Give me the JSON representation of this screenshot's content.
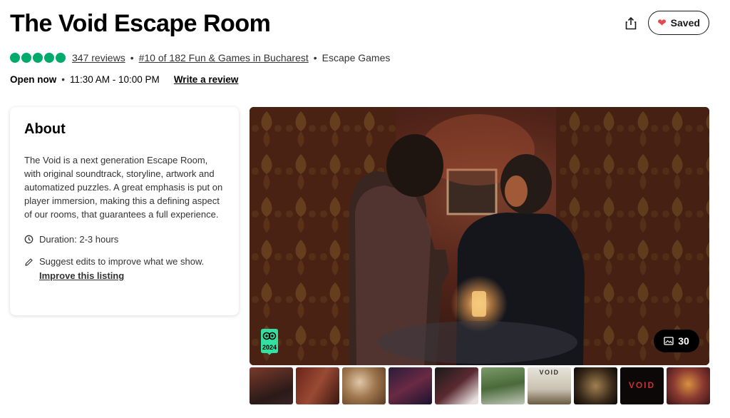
{
  "title": "The Void Escape Room",
  "header": {
    "saved_label": "Saved"
  },
  "rating": {
    "bubbles": 5,
    "reviews_link": "347 reviews",
    "ranking_link": "#10 of 182 Fun & Games in Bucharest",
    "category": "Escape Games"
  },
  "hours": {
    "status": "Open now",
    "time": "11:30 AM - 10:00 PM",
    "write_review": "Write a review"
  },
  "about": {
    "title": "About",
    "description": "The Void is a next generation Escape Room, with original soundtrack, storyline, artwork and automatized puzzles. A great emphasis is put on player immersion, making this a defining aspect of our rooms, that guarantees a full experience.",
    "duration": "Duration: 2-3 hours",
    "suggest": "Suggest edits to improve what we show.",
    "improve_link": "Improve this listing"
  },
  "gallery": {
    "photo_count": "30",
    "badge_year": "2024",
    "thumb_text_1": "VOID",
    "thumb_text_2": "VOID"
  },
  "icons": {
    "share": "share-icon",
    "heart": "heart-icon",
    "clock": "clock-icon",
    "pencil": "pencil-icon",
    "gallery": "image-icon"
  },
  "colors": {
    "rating_green": "#00aa6c",
    "heart_red": "#e5484d",
    "badge_green": "#34e0a1"
  }
}
